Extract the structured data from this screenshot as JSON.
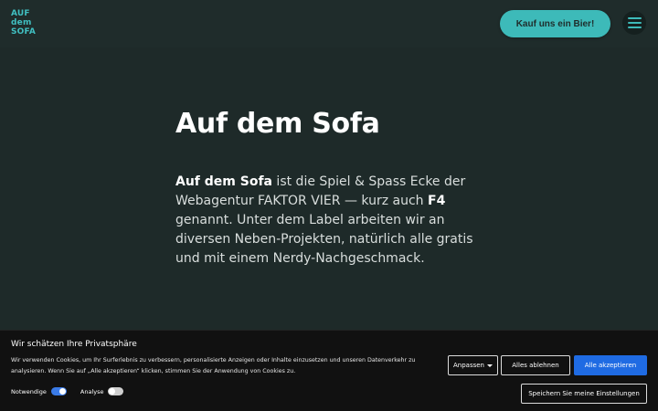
{
  "header": {
    "logo_lines": [
      "AUF",
      "dem",
      "SOFA"
    ],
    "beer_button": "Kauf uns ein Bier!",
    "accent_color": "#3dbab9"
  },
  "main": {
    "title": "Auf dem Sofa",
    "intro": {
      "strong1": "Auf dem Sofa",
      "text1": " ist die Spiel & Spass Ecke der Webagentur FAKTOR VIER — kurz auch ",
      "strong2": "F4",
      "text2": " genannt. Unter dem Label arbeiten wir an diversen Neben-Projekten, natürlich alle gratis und mit einem Nerdy-Nachgeschmack."
    }
  },
  "cookie": {
    "title": "Wir schätzen Ihre Privatsphäre",
    "text": "Wir verwenden Cookies, um Ihr Surferlebnis zu verbessern, personalisierte Anzeigen oder Inhalte einzusetzen und unseren Datenverkehr zu analysieren. Wenn Sie auf „Alle akzeptieren“ klicken, stimmen Sie der Anwendung von Cookies zu.",
    "toggles": [
      {
        "label": "Notwendige",
        "on": true
      },
      {
        "label": "Analyse",
        "on": false
      }
    ],
    "buttons": {
      "adjust": "Anpassen",
      "reject": "Alles ablehnen",
      "accept": "Alle akzeptieren",
      "save": "Speichern Sie meine Einstellungen"
    },
    "accept_color": "#1f6be3"
  }
}
